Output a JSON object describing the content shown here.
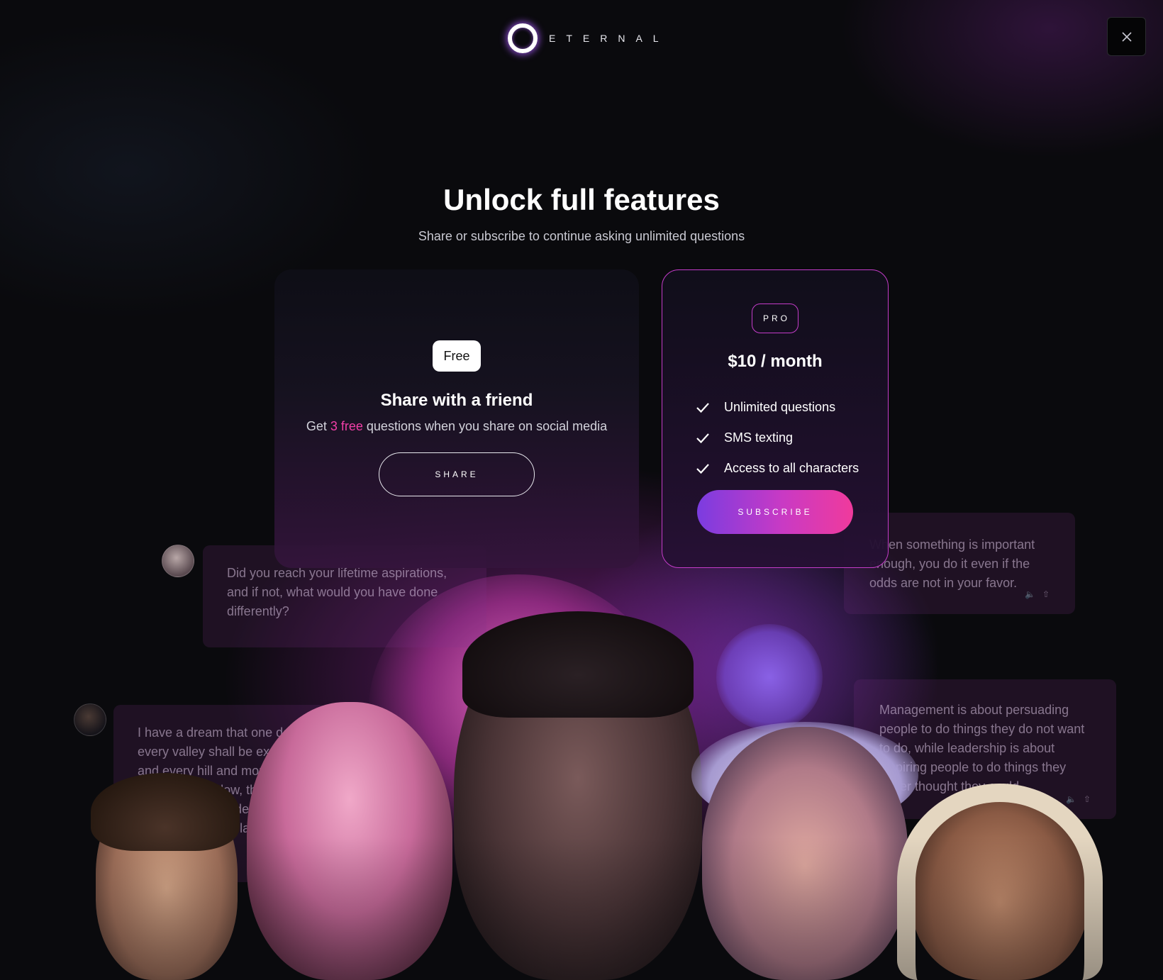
{
  "header": {
    "brand": "ETERNAL",
    "close_icon": "close-icon"
  },
  "hero": {
    "title": "Unlock full features",
    "subtitle": "Share or subscribe to continue asking unlimited questions"
  },
  "free_card": {
    "badge": "Free",
    "title": "Share with a friend",
    "desc_before": "Get ",
    "desc_highlight": "3 free",
    "desc_after": " questions when you share on social media",
    "button": "SHARE"
  },
  "pro_card": {
    "badge": "PRO",
    "price": "$10 / month",
    "features": [
      "Unlimited questions",
      "SMS texting",
      "Access to all characters"
    ],
    "button": "SUBSCRIBE"
  },
  "chat": {
    "bubble1": "Did you reach your lifetime aspirations, and if not, what would you have done differently?",
    "bubble2": "I have a dream that one day every valley shall be exalted, and every hill and mountain shall be made low, the rough places will be made plain, and the crooked places will be made straight",
    "bubble3": "When something is important enough, you do it even if the odds are not in your favor.",
    "bubble4": "Management is about persuading people to do things they do not want to do, while leadership is about inspiring people to do things they never thought they could."
  },
  "colors": {
    "accent_pink": "#f23fa8",
    "accent_purple": "#7b3ce0",
    "pro_border": "#c43cc9"
  }
}
